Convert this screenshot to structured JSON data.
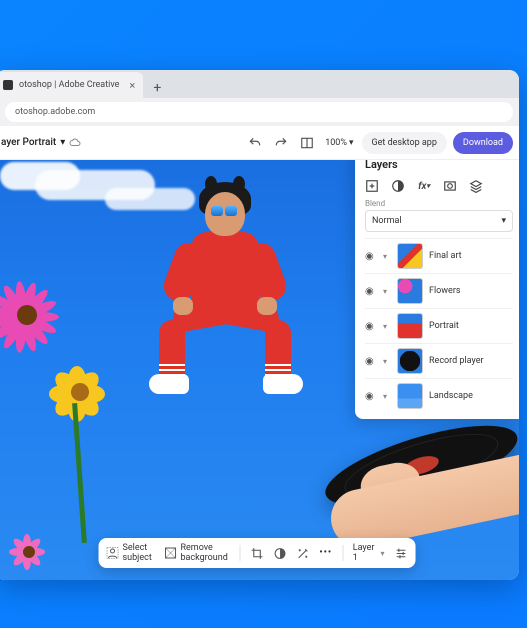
{
  "browser": {
    "tab_title": "otoshop | Adobe Creative",
    "url": "otoshop.adobe.com"
  },
  "appbar": {
    "file_name": "ayer Portrait",
    "zoom": "100%",
    "desktop_btn": "Get desktop app",
    "download_btn": "Download"
  },
  "layers_panel": {
    "title": "Layers",
    "blend_label": "Blend",
    "blend_mode": "Normal",
    "layers": [
      {
        "name": "Final art"
      },
      {
        "name": "Flowers"
      },
      {
        "name": "Portrait"
      },
      {
        "name": "Record player"
      },
      {
        "name": "Landscape"
      }
    ]
  },
  "action_bar": {
    "select_subject": "Select subject",
    "remove_bg": "Remove background",
    "layer_label": "Layer 1",
    "more": "•••"
  }
}
